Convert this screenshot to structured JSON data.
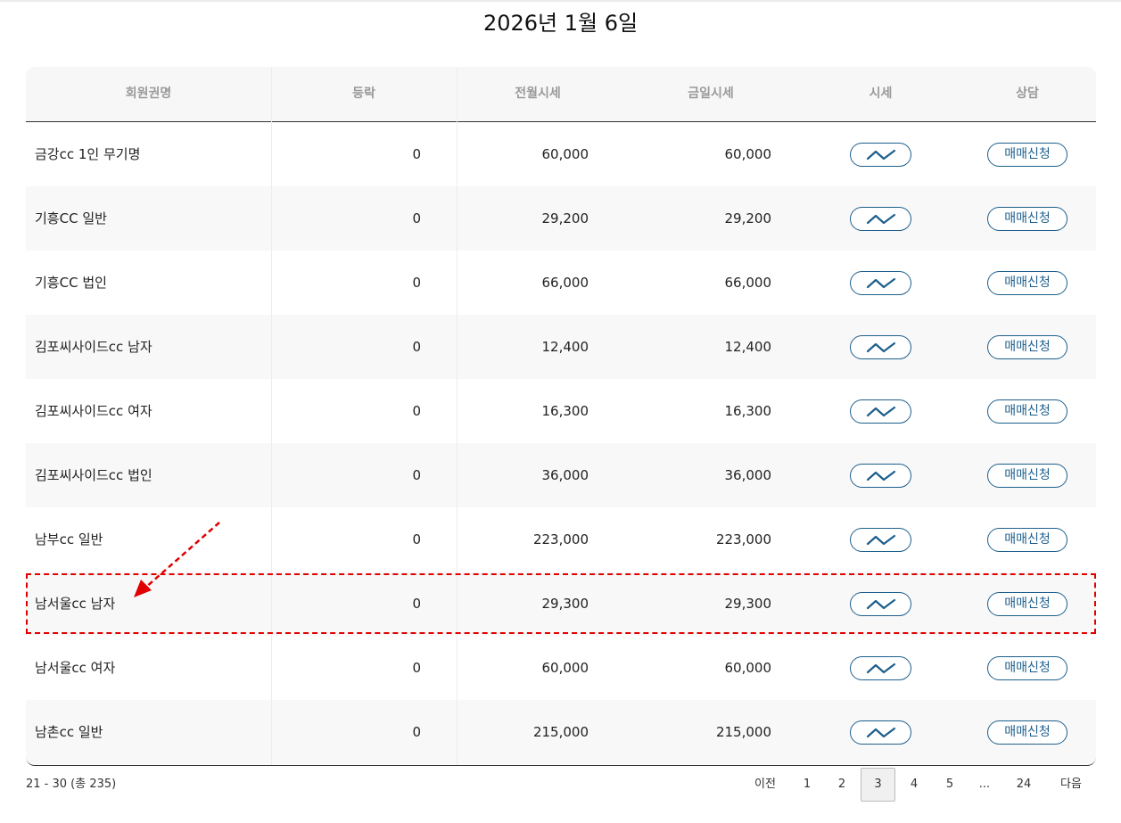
{
  "date_title": "2026년 1월 6일",
  "table": {
    "headers": [
      "회원권명",
      "등락",
      "전월시세",
      "금일시세",
      "시세",
      "상담"
    ],
    "rows": [
      {
        "name": "금강cc 1인 무기명",
        "change": "0",
        "prev_price": "60,000",
        "today_price": "60,000",
        "action": "매매신청"
      },
      {
        "name": "기흥CC 일반",
        "change": "0",
        "prev_price": "29,200",
        "today_price": "29,200",
        "action": "매매신청"
      },
      {
        "name": "기흥CC 법인",
        "change": "0",
        "prev_price": "66,000",
        "today_price": "66,000",
        "action": "매매신청"
      },
      {
        "name": "김포씨사이드cc 남자",
        "change": "0",
        "prev_price": "12,400",
        "today_price": "12,400",
        "action": "매매신청"
      },
      {
        "name": "김포씨사이드cc 여자",
        "change": "0",
        "prev_price": "16,300",
        "today_price": "16,300",
        "action": "매매신청"
      },
      {
        "name": "김포씨사이드cc 법인",
        "change": "0",
        "prev_price": "36,000",
        "today_price": "36,000",
        "action": "매매신청"
      },
      {
        "name": "남부cc 일반",
        "change": "0",
        "prev_price": "223,000",
        "today_price": "223,000",
        "action": "매매신청"
      },
      {
        "name": "남서울cc 남자",
        "change": "0",
        "prev_price": "29,300",
        "today_price": "29,300",
        "action": "매매신청"
      },
      {
        "name": "남서울cc 여자",
        "change": "0",
        "prev_price": "60,000",
        "today_price": "60,000",
        "action": "매매신청"
      },
      {
        "name": "남촌cc 일반",
        "change": "0",
        "prev_price": "215,000",
        "today_price": "215,000",
        "action": "매매신청"
      }
    ],
    "chart_icon": "trend-line-icon"
  },
  "footer": {
    "count_text": "21 - 30 (총 235)",
    "pagination": {
      "prev": "이전",
      "pages": [
        "1",
        "2",
        "3",
        "4",
        "5",
        "...",
        "24"
      ],
      "current": "3",
      "next": "다음"
    }
  },
  "colors": {
    "accent": "#1d5f8c",
    "highlight": "#e00000",
    "header_bg": "#f7f7f7",
    "alt_row_bg": "#f8f8f8"
  }
}
